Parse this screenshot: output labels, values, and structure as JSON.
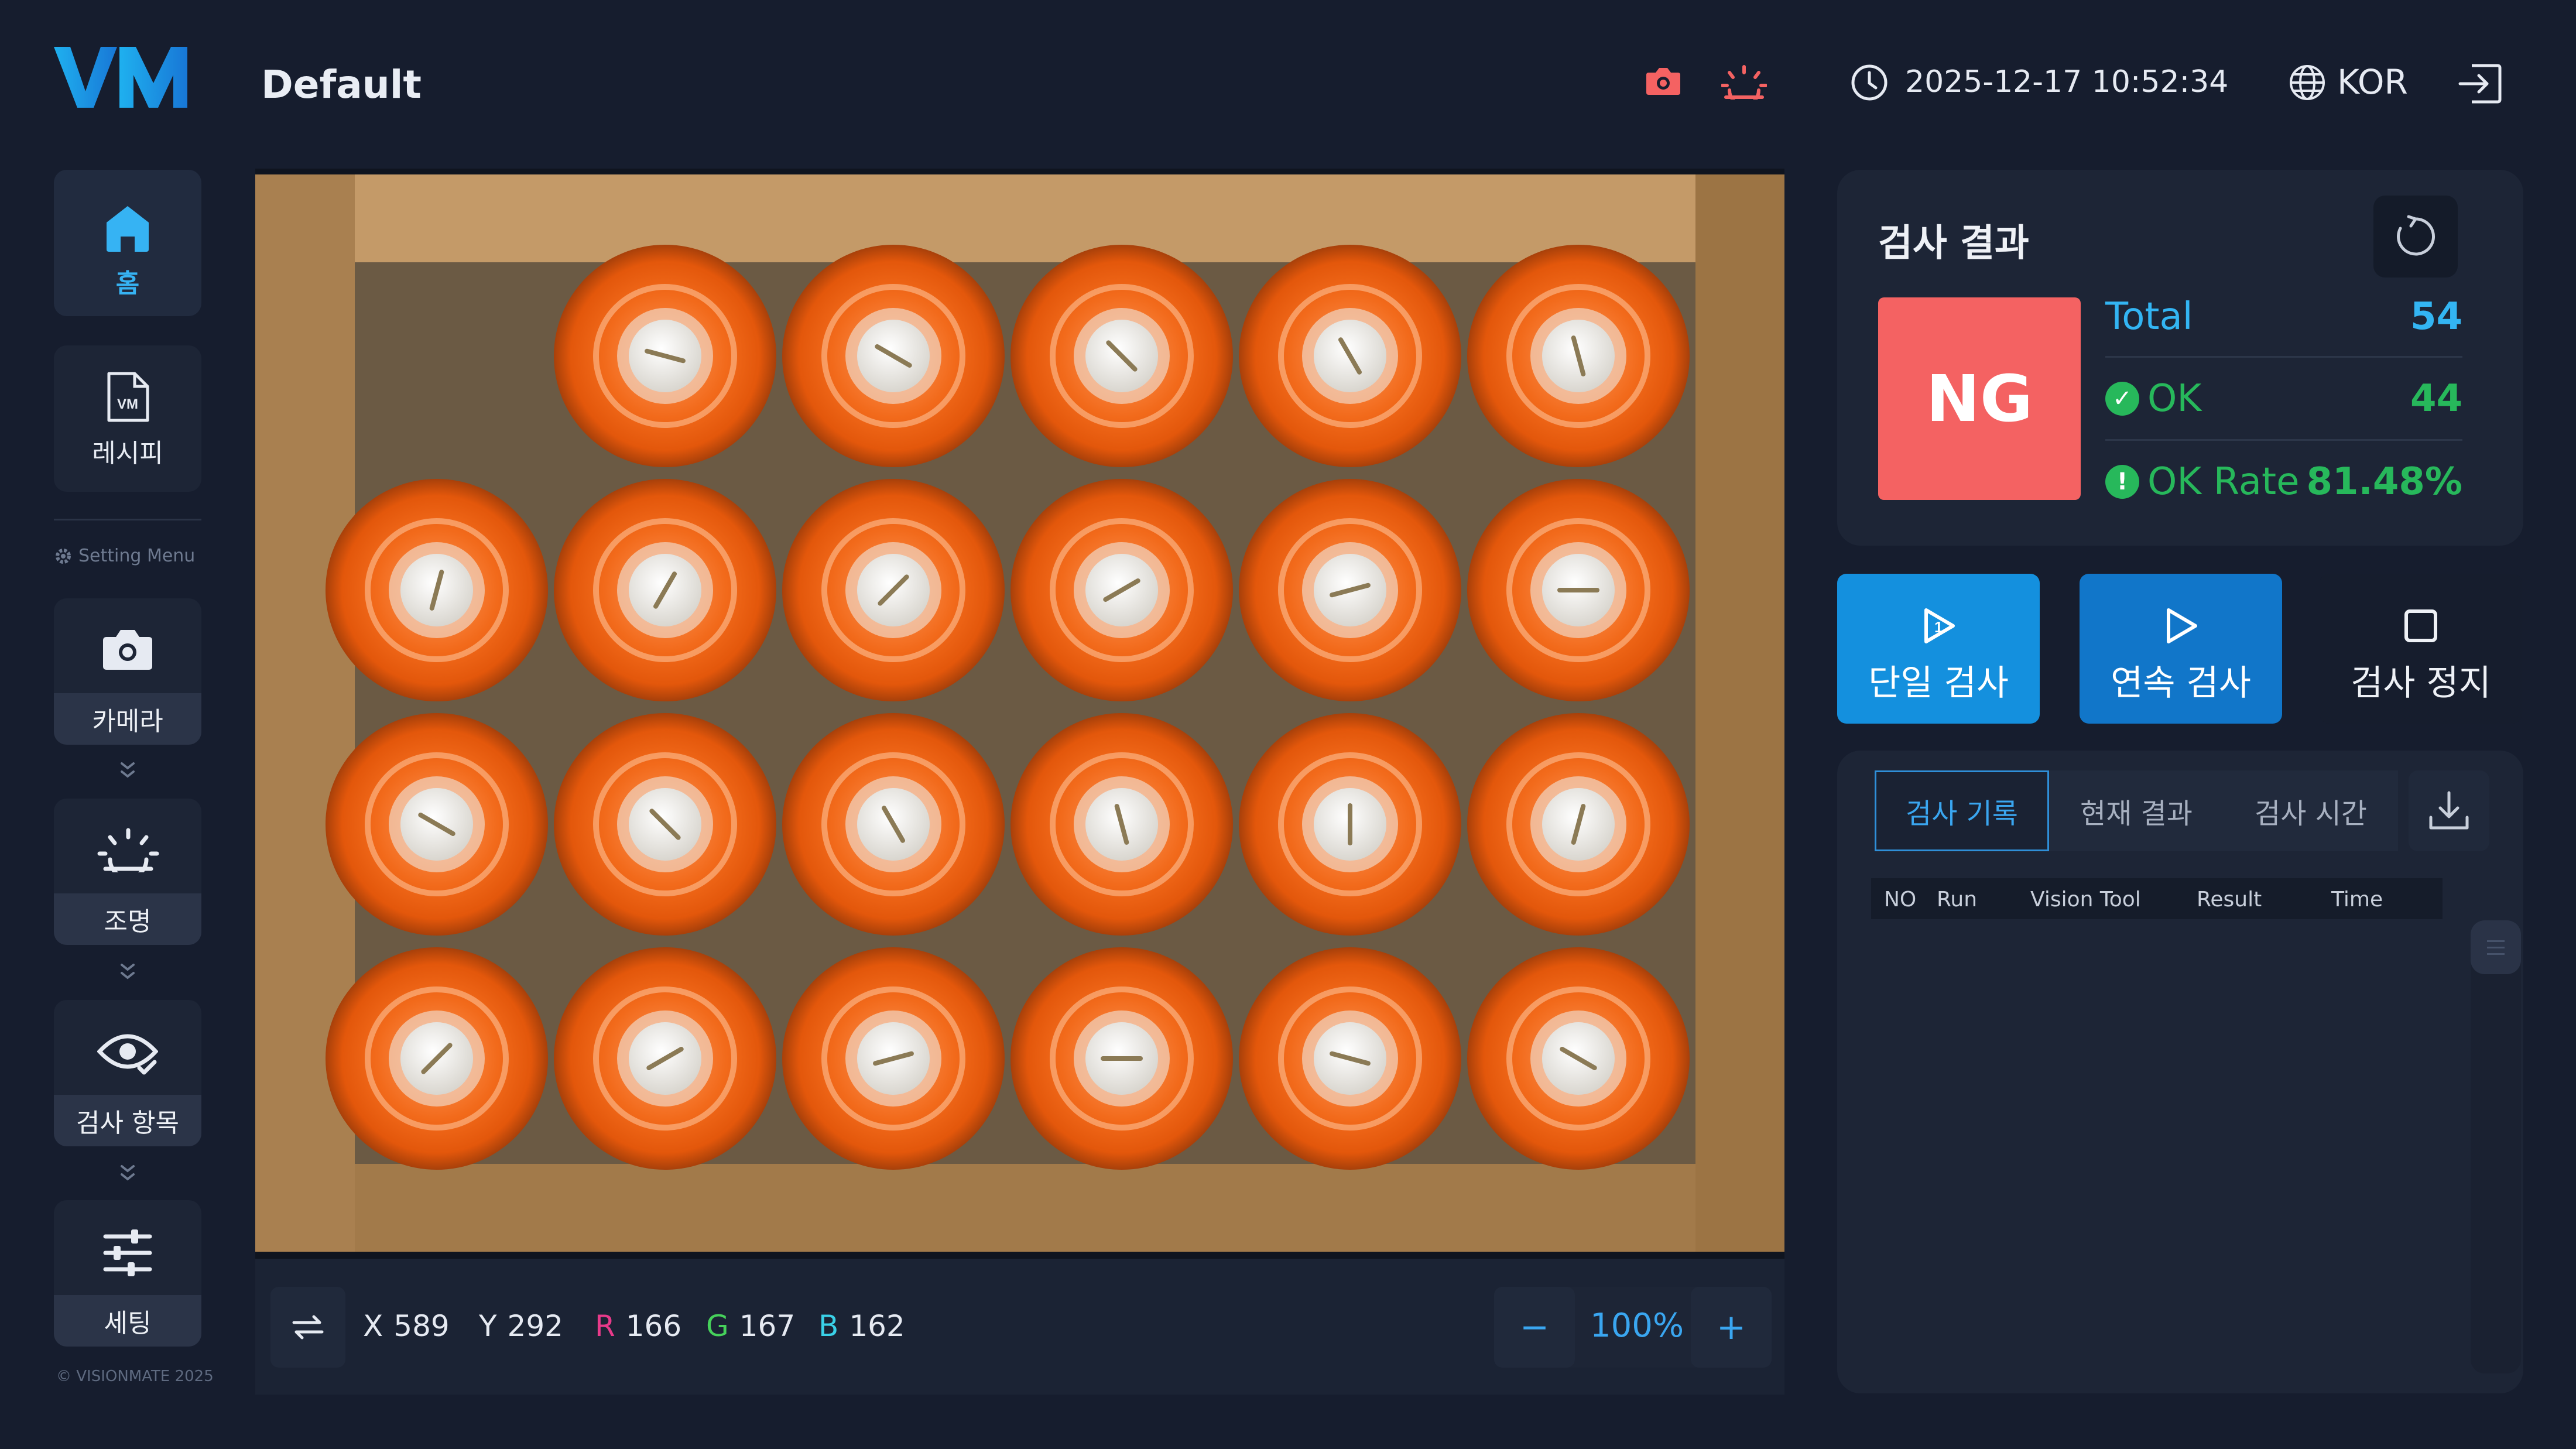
{
  "header": {
    "logo_text": "VM",
    "page_title": "Default",
    "datetime": "2025-12-17 10:52:34",
    "language": "KOR",
    "icons": [
      "camera-icon",
      "light-icon",
      "clock-icon",
      "globe-icon",
      "logout-icon"
    ],
    "accent_alert_color": "#f46262"
  },
  "sidebar": {
    "home_label": "홈",
    "recipe_label": "레시피",
    "setting_menu_label": "Setting Menu",
    "camera_label": "카메라",
    "light_label": "조명",
    "inspect_label": "검사 항목",
    "settings_label": "세팅",
    "copyright": "© VISIONMATE 2025"
  },
  "viewer": {
    "image_content": "Top view of a cardboard box with 4x6 rows of orange bottles",
    "x_label": "X",
    "x_value": "589",
    "y_label": "Y",
    "y_value": "292",
    "r_label": "R",
    "r_value": "166",
    "g_label": "G",
    "g_value": "167",
    "b_label": "B",
    "b_value": "162",
    "zoom_minus": "−",
    "zoom_value": "100%",
    "zoom_plus": "+"
  },
  "result": {
    "title": "검사 결과",
    "status": "NG",
    "status_color": "#f46262",
    "total_label": "Total",
    "total_value": "54",
    "ok_label": "OK",
    "ok_value": "44",
    "rate_label": "OK Rate",
    "rate_value": "81.48%"
  },
  "actions": {
    "single": "단일 검사",
    "continuous": "연속 검사",
    "stop": "검사 정지"
  },
  "log": {
    "tabs": [
      "검사 기록",
      "현재 결과",
      "검사 시간"
    ],
    "active_tab": "검사 기록",
    "columns": [
      "NO",
      "Run",
      "Vision Tool",
      "Result",
      "Time"
    ],
    "rows": []
  },
  "colors": {
    "background": "#161d2e",
    "panel": "#1d2536",
    "accent_blue": "#33b5f3",
    "ok_green": "#27b85b",
    "ng_red": "#f46262"
  }
}
